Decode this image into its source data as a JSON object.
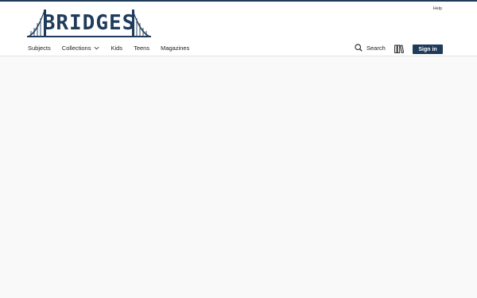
{
  "header": {
    "logo_text": "BRIDGES",
    "help_label": "Help",
    "nav": [
      {
        "label": "Subjects"
      },
      {
        "label": "Collections"
      },
      {
        "label": "Kids"
      },
      {
        "label": "Teens"
      },
      {
        "label": "Magazines"
      }
    ],
    "search_label": "Search",
    "signin_label": "Sign in",
    "icons": [
      "search-icon",
      "library-shelf-icon",
      "chevron-down-icon"
    ]
  },
  "colors": {
    "brand": "#1f3b5a",
    "background": "#f9f9f9",
    "header_bg": "#ffffff"
  }
}
